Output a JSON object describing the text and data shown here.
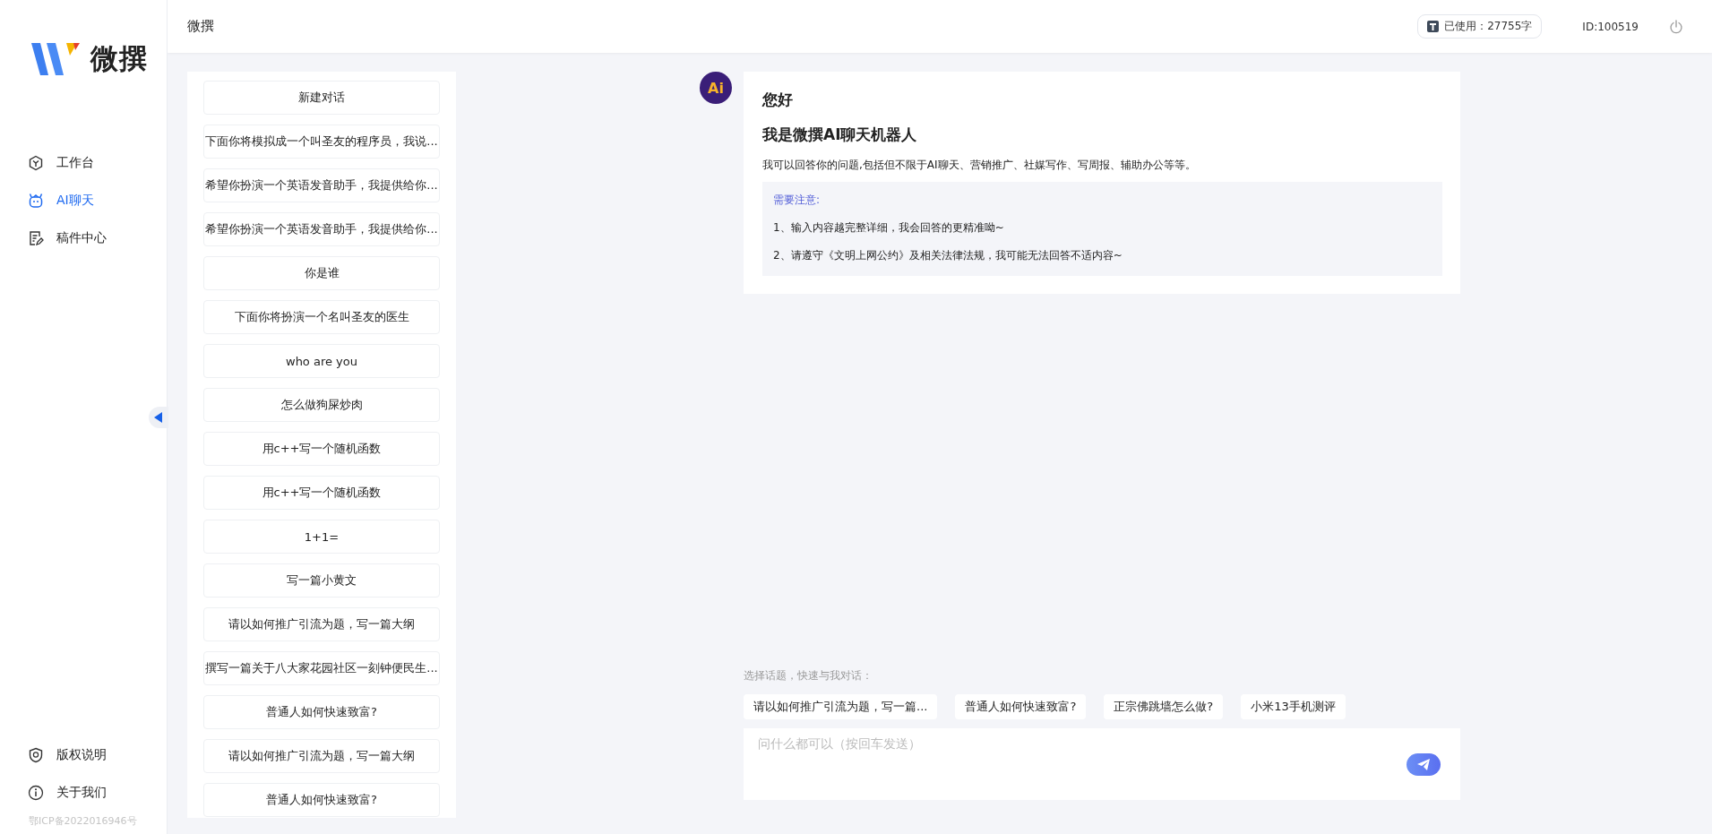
{
  "sidebar": {
    "logo_text": "微撰",
    "nav": [
      {
        "label": "工作台",
        "selected": false
      },
      {
        "label": "AI聊天",
        "selected": true
      },
      {
        "label": "稿件中心",
        "selected": false
      }
    ],
    "footer_nav": [
      {
        "label": "版权说明"
      },
      {
        "label": "关于我们"
      }
    ],
    "icp": "鄂ICP备2022016946号"
  },
  "header": {
    "title": "微撰",
    "usage": "已使用：27755字",
    "user_id": "ID:100519"
  },
  "conversations": [
    {
      "title": "新建对话",
      "selected": false
    },
    {
      "title": "下面你将模拟成一个叫圣友的程序员，我说...",
      "selected": false
    },
    {
      "title": "希望你扮演一个英语发音助手，我提供给你...",
      "selected": false
    },
    {
      "title": "希望你扮演一个英语发音助手，我提供给你...",
      "selected": false
    },
    {
      "title": "你是谁",
      "selected": false
    },
    {
      "title": "下面你将扮演一个名叫圣友的医生",
      "selected": false
    },
    {
      "title": "who are you",
      "selected": false
    },
    {
      "title": "怎么做狗屎炒肉",
      "selected": false
    },
    {
      "title": "用c++写一个随机函数",
      "selected": false
    },
    {
      "title": "用c++写一个随机函数",
      "selected": false
    },
    {
      "title": "1+1=",
      "selected": false
    },
    {
      "title": "写一篇小黄文",
      "selected": false
    },
    {
      "title": "请以如何推广引流为题，写一篇大纲",
      "selected": false
    },
    {
      "title": "撰写一篇关于八大家花园社区一刻钟便民生...",
      "selected": false
    },
    {
      "title": "普通人如何快速致富?",
      "selected": false
    },
    {
      "title": "请以如何推广引流为题，写一篇大纲",
      "selected": false
    },
    {
      "title": "普通人如何快速致富?",
      "selected": false
    }
  ],
  "chat": {
    "avatar_text": "Ai",
    "greeting": "您好",
    "heading": "我是微撰AI聊天机器人",
    "intro": "我可以回答你的问题,包括但不限于AI聊天、营销推广、社媒写作、写周报、辅助办公等等。",
    "notice": {
      "title": "需要注意:",
      "items": [
        "1、输入内容越完整详细，我会回答的更精准呦~",
        "2、请遵守《文明上网公约》及相关法律法规，我可能无法回答不适内容~"
      ]
    },
    "topics_label": "选择话题，快速与我对话：",
    "topics": [
      "请以如何推广引流为题，写一篇...",
      "普通人如何快速致富?",
      "正宗佛跳墙怎么做?",
      "小米13手机测评"
    ],
    "input": {
      "placeholder": "问什么都可以（按回车发送）"
    }
  }
}
